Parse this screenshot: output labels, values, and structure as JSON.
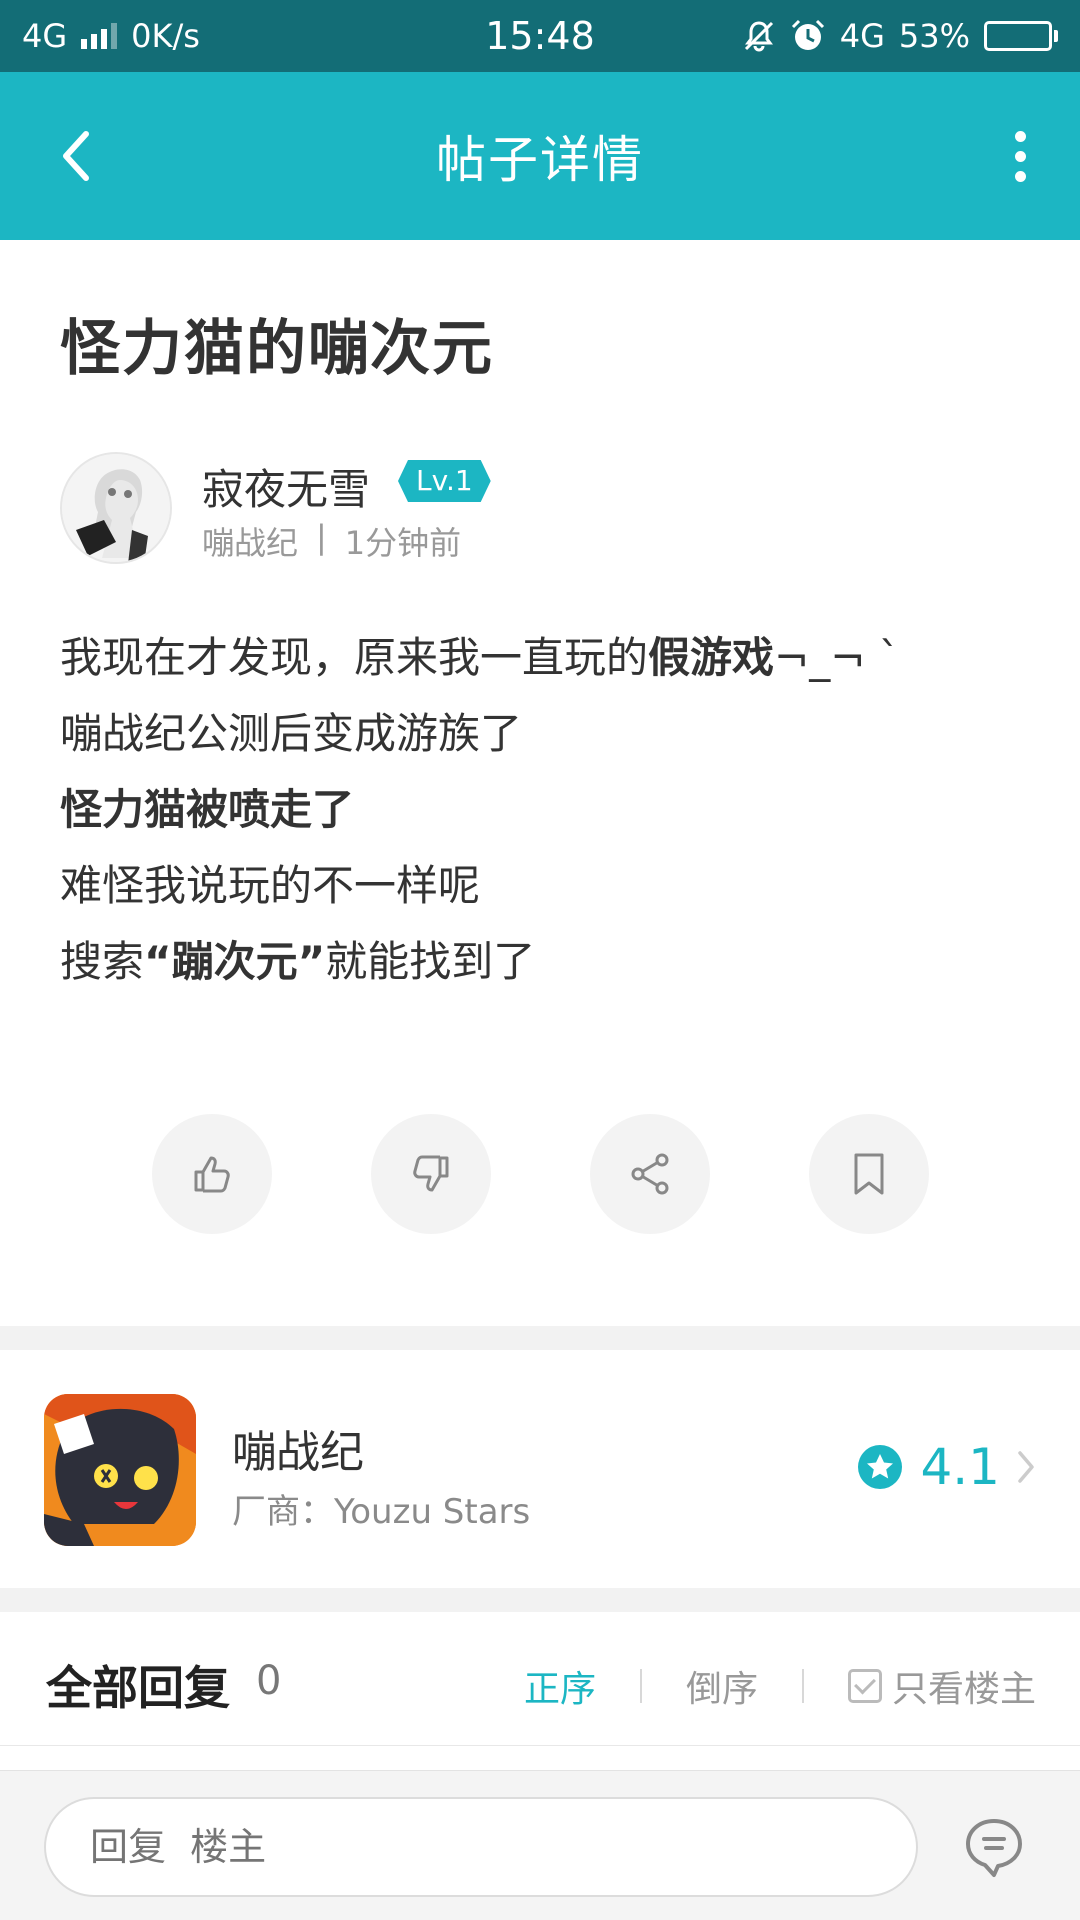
{
  "status_bar": {
    "network": "4G",
    "speed": "0K/s",
    "time": "15:48",
    "network2": "4G",
    "battery": "53%",
    "battery_level": 0.53
  },
  "app_bar": {
    "title": "帖子详情",
    "icons": [
      "back-chevron-icon",
      "more-vertical-icon"
    ]
  },
  "post": {
    "title": "怪力猫的嘣次元",
    "author": {
      "name": "寂夜无雪",
      "level": "Lv.1",
      "source": "嘣战纪",
      "separator": "|",
      "time": "1分钟前"
    },
    "body": {
      "line1_a": "我现在才发现，原来我一直玩的",
      "line1_b": "假游戏",
      "line1_c": "¬_¬ `",
      "line2": "嘣战纪公测后变成游族了",
      "line3": "怪力猫被喷走了",
      "line4": "难怪我说玩的不一样呢",
      "line5_a": "搜索",
      "line5_b": "“蹦次元”",
      "line5_c": "就能找到了"
    },
    "actions": [
      "thumbs-up-icon",
      "thumbs-down-icon",
      "share-icon",
      "bookmark-icon"
    ]
  },
  "game": {
    "name": "嘣战纪",
    "vendor": "厂商：Youzu Stars",
    "rating": "4.1"
  },
  "replies": {
    "title": "全部回复",
    "count": "0",
    "sort_asc": "正序",
    "sort_desc": "倒序",
    "only_op": "只看楼主"
  },
  "bottom_bar": {
    "placeholder": "回复  楼主"
  },
  "colors": {
    "accent": "#1cb6c3",
    "status_bar": "#136d76"
  }
}
